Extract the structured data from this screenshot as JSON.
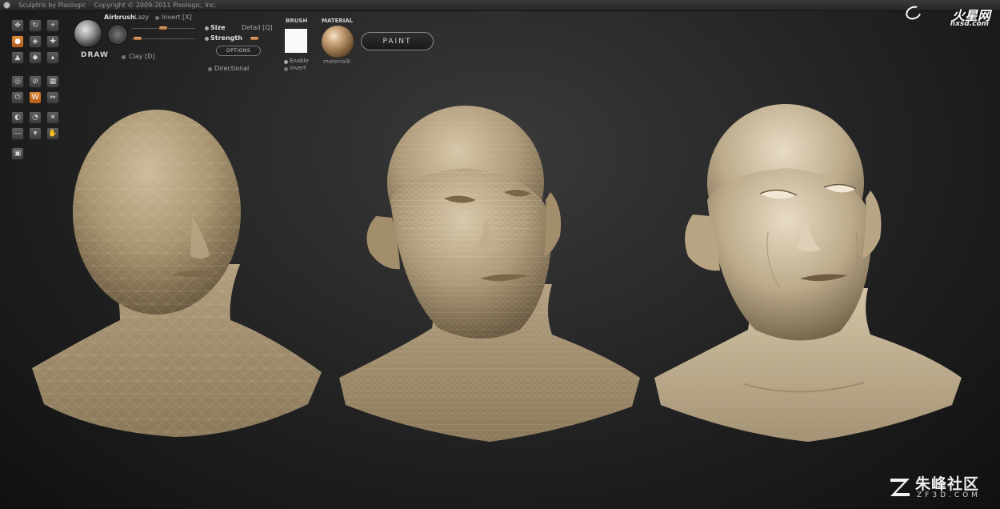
{
  "window": {
    "title": "Sculptris by Pixologic",
    "copyright": "Copyright © 2009-2011 Pixologic, Inc."
  },
  "watermarks": {
    "top_brand": "火星网",
    "top_site": "hxsd.com",
    "bottom_brand": "朱峰社区",
    "bottom_site": "ZF3D.COM"
  },
  "toolbar": {
    "brush_name": "DRAW",
    "airbrush_label": "Airbrush",
    "lazy_label": "Lazy",
    "invert_label": "Invert [X]",
    "clay_label": "Clay [D]",
    "size_label": "Size",
    "detail_label": "Detail [Q]",
    "strength_label": "Strength",
    "options_label": "OPTIONS",
    "directional_label": "Directional",
    "brush_section": "BRUSH",
    "brush_enable": "Enable",
    "brush_invert": "Invert",
    "material_section": "MATERIAL",
    "material_name": "material8",
    "paint_label": "PAINT"
  },
  "tools": [
    {
      "icon": "rotate-icon",
      "glyph": "✥"
    },
    {
      "icon": "refresh-icon",
      "glyph": "↻"
    },
    {
      "icon": "pin-icon",
      "glyph": "⌖"
    },
    {
      "icon": "draw-tool-icon",
      "glyph": "●"
    },
    {
      "icon": "crease-icon",
      "glyph": "◈"
    },
    {
      "icon": "grab-icon",
      "glyph": "✚"
    },
    {
      "icon": "flatten-icon",
      "glyph": "▲"
    },
    {
      "icon": "inflate-icon",
      "glyph": "◆"
    },
    {
      "icon": "pinch-icon",
      "glyph": "▴"
    },
    {
      "icon": "smooth-icon",
      "glyph": "◎"
    },
    {
      "icon": "scale-icon",
      "glyph": "⊘"
    },
    {
      "icon": "reduce-icon",
      "glyph": "▦"
    },
    {
      "icon": "symmetry-icon",
      "glyph": "⏻"
    },
    {
      "icon": "wireframe-icon",
      "glyph": "W"
    },
    {
      "icon": "mirror-icon",
      "glyph": "⇔"
    },
    {
      "icon": "mask-icon",
      "glyph": "◐"
    },
    {
      "icon": "paint-icon",
      "glyph": "◔"
    },
    {
      "icon": "spray-icon",
      "glyph": "✶"
    },
    {
      "icon": "minus-icon",
      "glyph": "—"
    },
    {
      "icon": "bucket-icon",
      "glyph": "▾"
    },
    {
      "icon": "hand-icon",
      "glyph": "✋"
    },
    {
      "icon": "camera-icon",
      "glyph": "▣"
    }
  ],
  "colors": {
    "active_tool": "#d0722a",
    "skin_base": "#b3a184",
    "skin_light": "#d8c8ab",
    "wire": "#e8dcc8"
  }
}
